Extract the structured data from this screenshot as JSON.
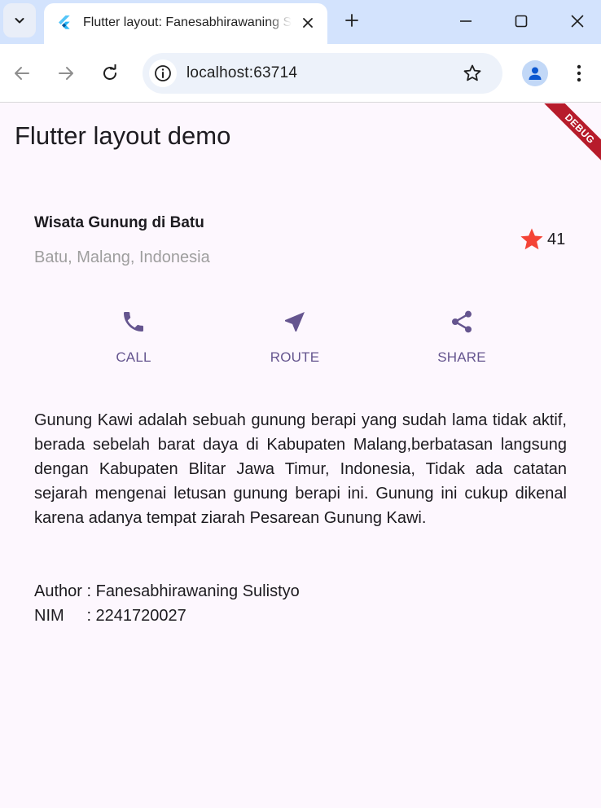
{
  "browser": {
    "tab_title": "Flutter layout: Fanesabhirawaning Sulistyo",
    "url": "localhost:63714"
  },
  "app": {
    "appbar_title": "Flutter layout demo",
    "debug_banner": "DEBUG",
    "title_section": {
      "title": "Wisata Gunung di Batu",
      "subtitle": "Batu, Malang, Indonesia",
      "rating_count": "41",
      "star_color": "#f44336"
    },
    "buttons": [
      {
        "label": "CALL",
        "icon": "phone-icon"
      },
      {
        "label": "ROUTE",
        "icon": "near-me-icon"
      },
      {
        "label": "SHARE",
        "icon": "share-icon"
      }
    ],
    "accent_color": "#65558f",
    "description": "Gunung Kawi adalah sebuah gunung berapi yang sudah lama tidak aktif, berada sebelah barat daya di Kabupaten Malang,berbatasan langsung dengan Kabupaten Blitar Jawa Timur, Indonesia, Tidak ada catatan sejarah mengenai letusan gunung berapi ini. Gunung ini cukup dikenal karena adanya tempat ziarah Pesarean Gunung Kawi.",
    "author_line": "Author : Fanesabhirawaning Sulistyo",
    "nim_line": "NIM     : 2241720027"
  }
}
